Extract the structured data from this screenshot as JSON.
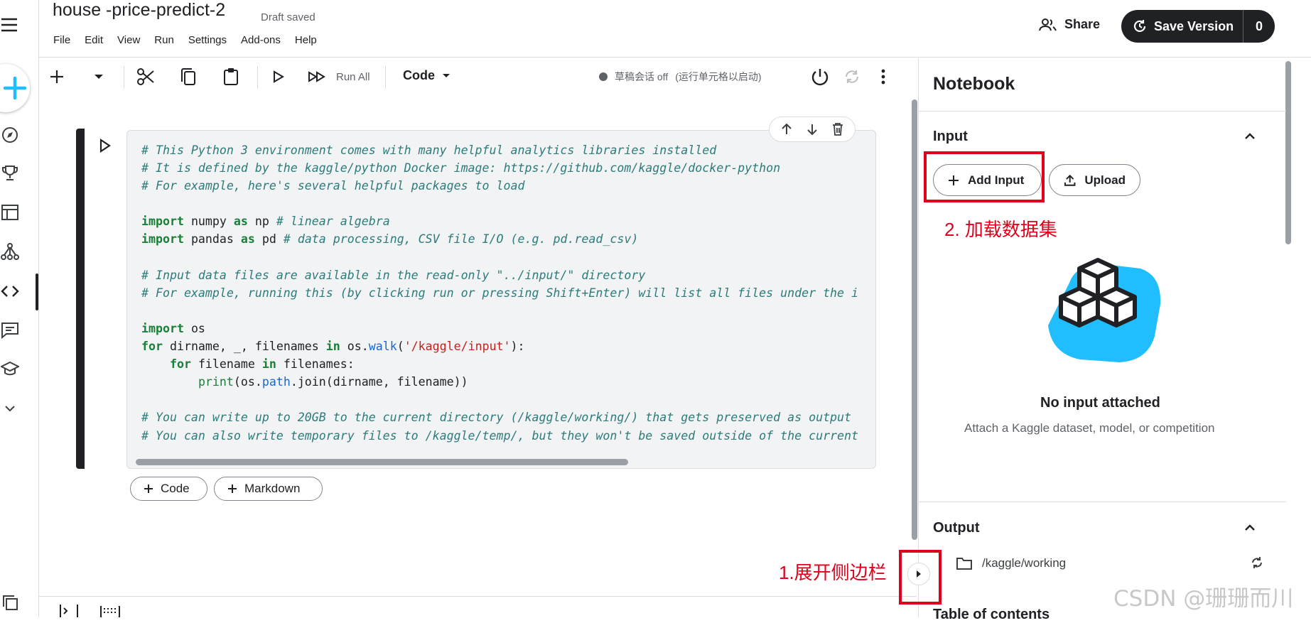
{
  "header": {
    "title": "house -price-predict-2",
    "status": "Draft saved",
    "menu": [
      "File",
      "Edit",
      "View",
      "Run",
      "Settings",
      "Add-ons",
      "Help"
    ],
    "share_label": "Share",
    "save_label": "Save Version",
    "save_count": "0"
  },
  "toolbar": {
    "run_all_label": "Run All",
    "cell_type": "Code",
    "session_label": "草稿会话 off",
    "session_hint": "(运行单元格以启动)"
  },
  "cell": {
    "code_lines": [
      "# This Python 3 environment comes with many helpful analytics libraries installed",
      "# It is defined by the kaggle/python Docker image: https://github.com/kaggle/docker-python",
      "# For example, here's several helpful packages to load",
      "",
      "import numpy as np # linear algebra",
      "import pandas as pd # data processing, CSV file I/O (e.g. pd.read_csv)",
      "",
      "# Input data files are available in the read-only \"../input/\" directory",
      "# For example, running this (by clicking run or pressing Shift+Enter) will list all files under the i",
      "",
      "import os",
      "for dirname, _, filenames in os.walk('/kaggle/input'):",
      "    for filename in filenames:",
      "        print(os.path.join(dirname, filename))",
      "",
      "# You can write up to 20GB to the current directory (/kaggle/working/) that gets preserved as output",
      "# You can also write temporary files to /kaggle/temp/, but they won't be saved outside of the current"
    ]
  },
  "add_cell": {
    "code_label": "Code",
    "markdown_label": "Markdown"
  },
  "sidebar": {
    "title": "Notebook",
    "input": {
      "heading": "Input",
      "add_input_label": "Add Input",
      "upload_label": "Upload",
      "empty_title": "No input attached",
      "empty_subtitle": "Attach a Kaggle dataset, model, or competition"
    },
    "output": {
      "heading": "Output",
      "folder": "/kaggle/working"
    },
    "toc_heading": "Table of contents"
  },
  "annotations": {
    "step1": "1.展开侧边栏",
    "step2": "2. 加载数据集",
    "color": "#e0001b"
  },
  "watermark": "CSDN @珊珊而川",
  "colors": {
    "accent_blue": "#20beff",
    "dark": "#202124"
  }
}
